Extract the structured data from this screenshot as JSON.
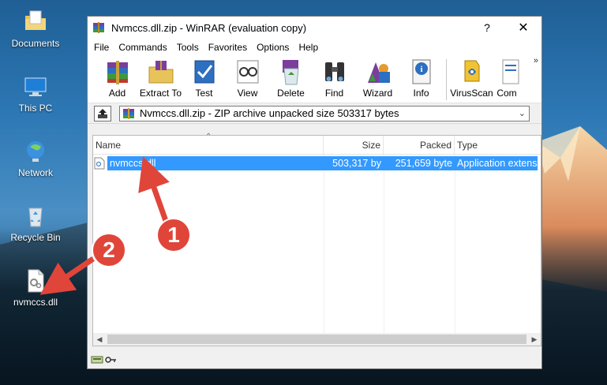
{
  "desktop": {
    "icons": [
      {
        "name": "Documents",
        "icon": "folder-icon"
      },
      {
        "name": "This PC",
        "icon": "computer-icon"
      },
      {
        "name": "Network",
        "icon": "network-icon"
      },
      {
        "name": "Recycle Bin",
        "icon": "recycle-bin-icon"
      },
      {
        "name": "nvmccs.dll",
        "icon": "dll-file-icon"
      }
    ]
  },
  "window": {
    "title": "Nvmccs.dll.zip - WinRAR (evaluation copy)",
    "help_label": "?",
    "close_label": "✕",
    "menu": [
      "File",
      "Commands",
      "Tools",
      "Favorites",
      "Options",
      "Help"
    ],
    "toolbar": [
      {
        "label": "Add",
        "icon": "add-archive-icon"
      },
      {
        "label": "Extract To",
        "icon": "extract-folder-icon"
      },
      {
        "label": "Test",
        "icon": "test-checkmark-icon"
      },
      {
        "label": "View",
        "icon": "view-glasses-icon"
      },
      {
        "label": "Delete",
        "icon": "delete-recycle-icon"
      },
      {
        "label": "Find",
        "icon": "find-binoculars-icon"
      },
      {
        "label": "Wizard",
        "icon": "wizard-icon"
      },
      {
        "label": "Info",
        "icon": "info-icon"
      },
      {
        "label": "VirusScan",
        "icon": "virus-scan-icon"
      },
      {
        "label": "Com",
        "icon": "comment-icon"
      }
    ],
    "toolbar_more": "»",
    "address": "Nvmccs.dll.zip - ZIP archive unpacked size 503317 bytes",
    "columns": {
      "name": "Name",
      "size": "Size",
      "packed": "Packed",
      "type": "Type"
    },
    "files": [
      {
        "name": "nvmccs.dll",
        "size": "503,317 by",
        "packed": "251,659 byte",
        "type": "Application extens"
      }
    ]
  },
  "annotations": {
    "badge1": "1",
    "badge2": "2",
    "color": "#e0453a"
  }
}
